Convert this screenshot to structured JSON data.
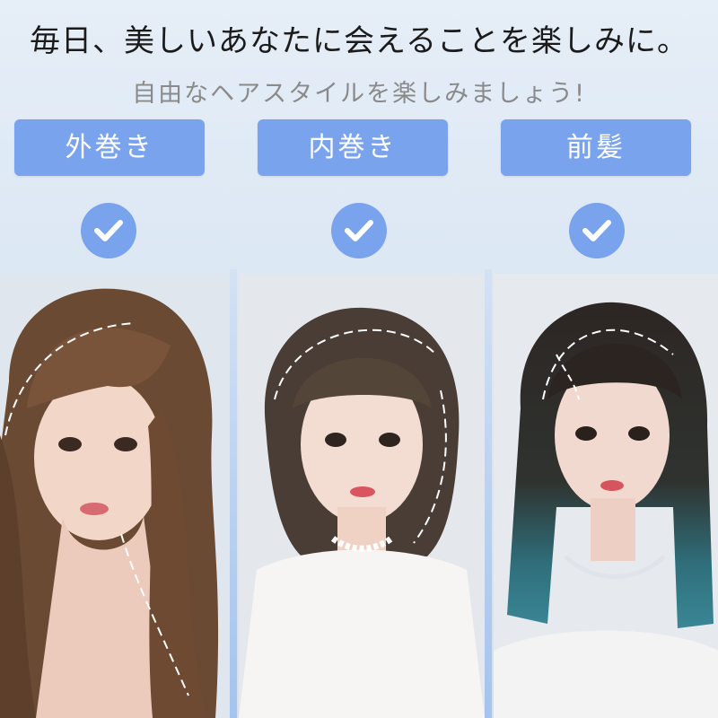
{
  "headline": "毎日、美しいあなたに会えることを楽しみに。",
  "subline": "自由なヘアスタイルを楽しみましょう!",
  "styles": [
    {
      "label": "外巻き",
      "icon": "check-circle-icon"
    },
    {
      "label": "内巻き",
      "icon": "check-circle-icon"
    },
    {
      "label": "前髪",
      "icon": "check-circle-icon"
    }
  ],
  "colors": {
    "accent": "#7aa3ee",
    "background": "#dbe7f4",
    "headline": "#1b1b1b",
    "subline": "#8a8a8a"
  }
}
